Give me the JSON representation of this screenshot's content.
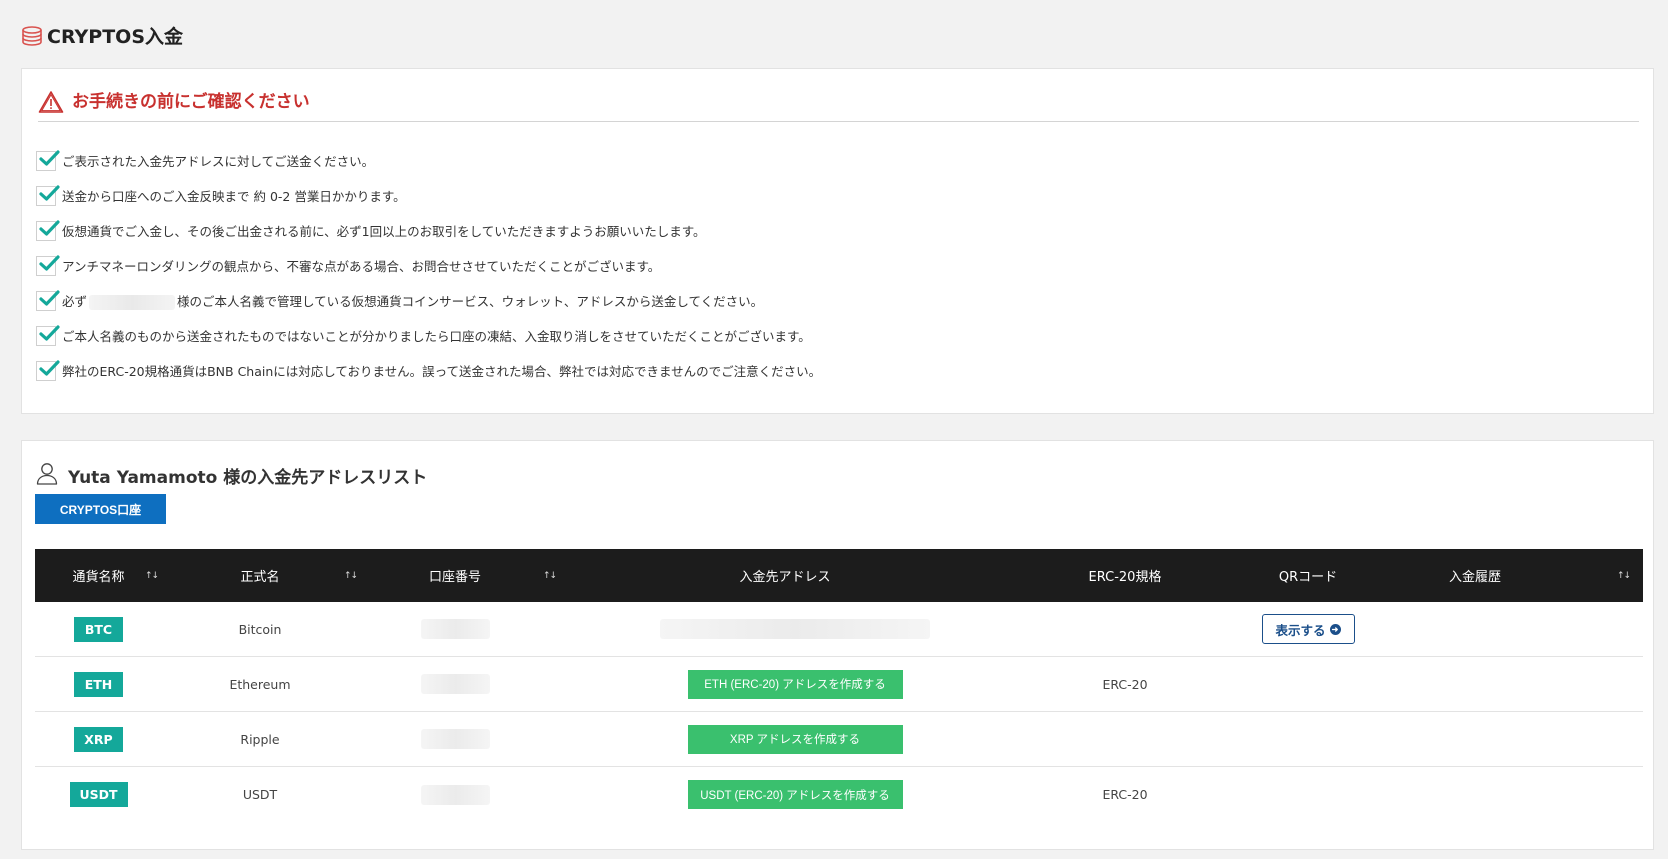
{
  "page": {
    "title": "CRYPTOS入金",
    "title_icon": "coins-icon",
    "accent_color": "#c8312f"
  },
  "notice": {
    "title": "お手続きの前にご確認ください",
    "items": [
      "ご表示された入金先アドレスに対してご送金ください。",
      "送金から口座へのご入金反映まで 約 0-2 営業日かかります。",
      "仮想通貨でご入金し、その後ご出金される前に、必ず1回以上のお取引をしていただきますようお願いいたします。",
      "アンチマネーロンダリングの観点から、不審な点がある場合、お問合せさせていただくことがございます。",
      "ご本人名義のものから送金されたものではないことが分かりましたら口座の凍結、入金取り消しをさせていただくことがございます。",
      "弊社のERC-20規格通貨はBNB Chainには対応しておりません。誤って送金された場合、弊社では対応できませんのでご注意ください。"
    ],
    "name_item": {
      "prefix": "必ず",
      "suffix": "様のご本人名義で管理している仮想通貨コインサービス、ウォレット、アドレスから送金してください。"
    }
  },
  "address_list": {
    "title": "Yuta Yamamoto 様の入金先アドレスリスト",
    "tab_label": "CRYPTOS口座",
    "columns": [
      "通貨名称",
      "正式名",
      "口座番号",
      "入金先アドレス",
      "ERC-20規格",
      "QRコード",
      "入金履歴"
    ],
    "sort_glyph": "↑↓",
    "rows": [
      {
        "ticker": "BTC",
        "name": "Bitcoin",
        "erc": "",
        "action": "",
        "qr_label": "表示する"
      },
      {
        "ticker": "ETH",
        "name": "Ethereum",
        "erc": "ERC-20",
        "action": "ETH (ERC-20) アドレスを作成する",
        "qr_label": ""
      },
      {
        "ticker": "XRP",
        "name": "Ripple",
        "erc": "",
        "action": "XRP アドレスを作成する",
        "qr_label": ""
      },
      {
        "ticker": "USDT",
        "name": "USDT",
        "erc": "ERC-20",
        "action": "USDT (ERC-20) アドレスを作成する",
        "qr_label": ""
      }
    ]
  },
  "colors": {
    "ticker_bg": "#14a89a",
    "create_button": "#3ac06e",
    "tab_button": "#0e6fc0",
    "table_header": "#1c1c1c"
  }
}
